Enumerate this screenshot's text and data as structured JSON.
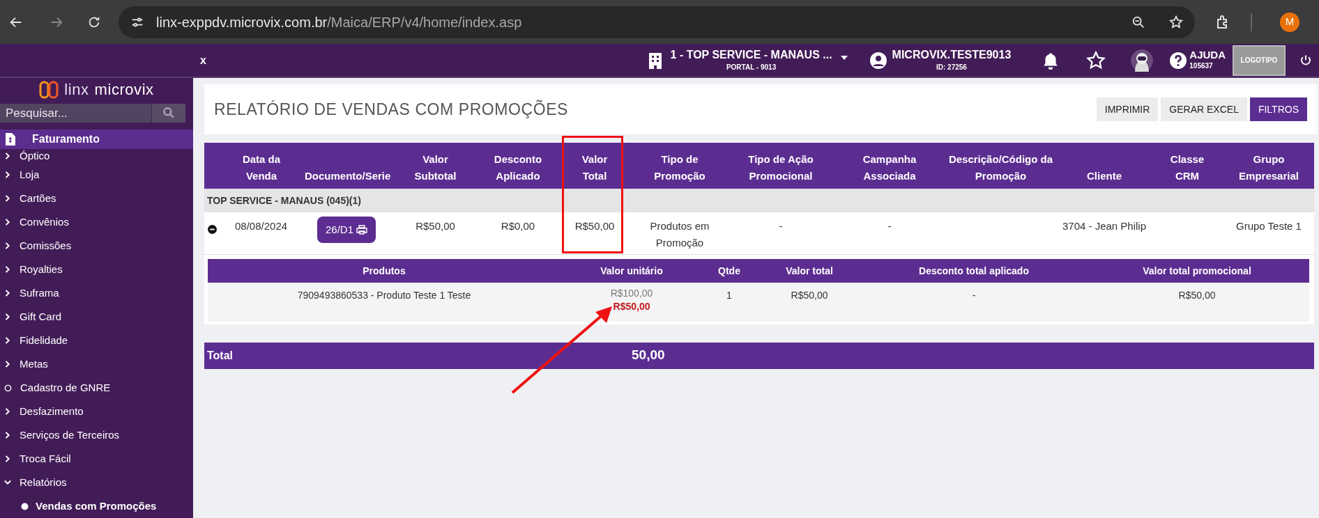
{
  "browser": {
    "url_host": "linx-exppdv.microvix.com.br",
    "url_path": "/Maica/ERP/v4/home/index.asp",
    "profile_initial": "M"
  },
  "app_header": {
    "close_label": "x",
    "store": "1 - TOP SERVICE - MANAUS ...",
    "portal": "PORTAL - 9013",
    "user": "MICROVIX.TESTE9013",
    "user_id": "ID: 27256",
    "help": "AJUDA",
    "help_code": "105637",
    "logo_button": "LOGOTIPO"
  },
  "sidebar": {
    "logo_light": "linx",
    "logo_bold": "microvix",
    "search": {
      "placeholder": "Pesquisar..."
    },
    "section": "Faturamento",
    "items": [
      {
        "label": "Óptico",
        "kind": "folder",
        "expanded": false
      },
      {
        "label": "Loja",
        "kind": "folder",
        "expanded": false
      },
      {
        "label": "Cartões",
        "kind": "folder",
        "expanded": false
      },
      {
        "label": "Convênios",
        "kind": "folder",
        "expanded": false
      },
      {
        "label": "Comissões",
        "kind": "folder",
        "expanded": false
      },
      {
        "label": "Royalties",
        "kind": "folder",
        "expanded": false
      },
      {
        "label": "Suframa",
        "kind": "folder",
        "expanded": false
      },
      {
        "label": "Gift Card",
        "kind": "folder",
        "expanded": false
      },
      {
        "label": "Fidelidade",
        "kind": "folder",
        "expanded": false
      },
      {
        "label": "Metas",
        "kind": "folder",
        "expanded": false
      },
      {
        "label": "Cadastro de GNRE",
        "kind": "page"
      },
      {
        "label": "Desfazimento",
        "kind": "folder",
        "expanded": false
      },
      {
        "label": "Serviços de Terceiros",
        "kind": "folder",
        "expanded": false
      },
      {
        "label": "Troca Fácil",
        "kind": "folder",
        "expanded": false
      },
      {
        "label": "Relatórios",
        "kind": "folder",
        "expanded": true,
        "children": [
          {
            "label": "Vendas com Promoções",
            "selected": true
          }
        ]
      }
    ]
  },
  "page": {
    "title": "RELATÓRIO DE VENDAS COM PROMOÇÕES",
    "buttons": [
      {
        "label": "IMPRIMIR",
        "primary": false
      },
      {
        "label": "GERAR EXCEL",
        "primary": false
      },
      {
        "label": "FILTROS",
        "primary": true
      }
    ]
  },
  "table": {
    "columns": [
      "Data da\nVenda",
      "Documento/Serie",
      "Valor\nSubtotal",
      "Desconto\nAplicado",
      "Valor\nTotal",
      "Tipo de\nPromoção",
      "Tipo de Ação\nPromocional",
      "Campanha\nAssociada",
      "Descrição/Código da\nPromoção",
      "Cliente",
      "Classe\nCRM",
      "Grupo\nEmpresarial"
    ],
    "group": "TOP SERVICE - MANAUS (045)(1)",
    "rows": [
      {
        "expanded": true,
        "date": "08/08/2024",
        "document": "26/D1",
        "subtotal": "R$50,00",
        "discount": "R$0,00",
        "total": "R$50,00",
        "promo_type": "Produtos em Promoção",
        "action_type": "-",
        "campaign": "-",
        "client": "3704 - Jean Philip",
        "business_group": "Grupo Teste 1",
        "items": {
          "columns": [
            "Produtos",
            "Valor unitário",
            "Qtde",
            "Valor total",
            "Desconto total aplicado",
            "Valor total promocional"
          ],
          "rows": [
            {
              "product": "7909493860533 - Produto Teste 1 Teste",
              "unit_price": "R$100,00",
              "promo_unit_price": "R$50,00",
              "qty": "1",
              "total": "R$50,00",
              "discount": "-",
              "promo_total": "R$50,00"
            }
          ]
        }
      }
    ]
  },
  "total": {
    "label": "Total",
    "value": "50,00"
  }
}
